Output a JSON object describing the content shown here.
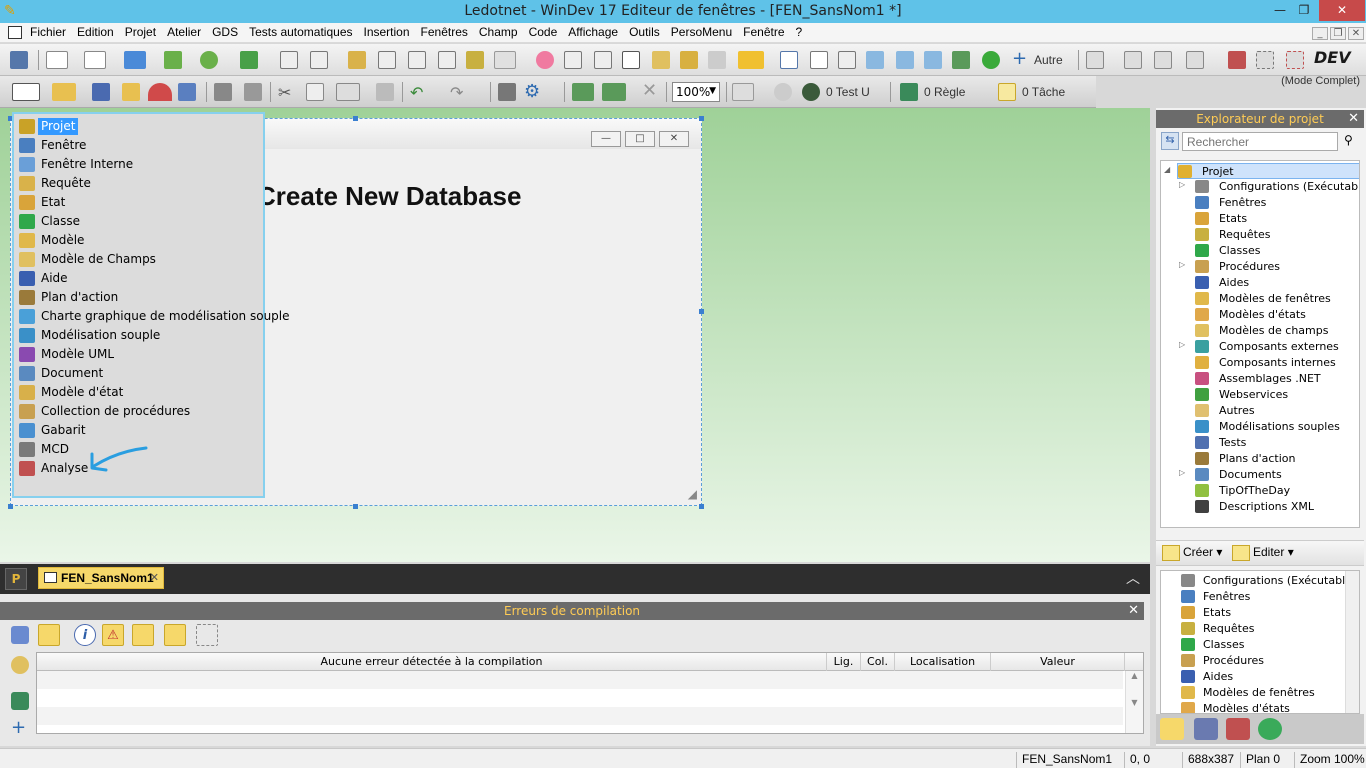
{
  "window": {
    "title": "Ledotnet - WinDev 17  Editeur de fenêtres - [FEN_SansNom1 *]",
    "minimize": "—",
    "restore": "❐",
    "close": "✕"
  },
  "menubar": {
    "items": [
      "Fichier",
      "Edition",
      "Projet",
      "Atelier",
      "GDS",
      "Tests automatiques",
      "Insertion",
      "Fenêtres",
      "Champ",
      "Code",
      "Affichage",
      "Outils",
      "PersoMenu",
      "Fenêtre",
      "?"
    ],
    "mdi_minimize": "_",
    "mdi_restore": "❐",
    "mdi_close": "✕"
  },
  "toolbar1": {
    "autre_label": "Autre",
    "mode_label": "(Mode Complet)",
    "logo": "DEV"
  },
  "toolbar2": {
    "zoom": "100%",
    "test_label": "0 Test U",
    "regle_label": "0 Règle",
    "tache_label": "0 Tâche"
  },
  "editor": {
    "heading": "Create New Database",
    "min_btn": "—",
    "max_btn": "□",
    "close_btn": "✕",
    "grip": "◢"
  },
  "new_menu": {
    "items": [
      {
        "label": "Projet",
        "color": "#c9a227",
        "selected": true
      },
      {
        "label": "Fenêtre",
        "color": "#4a7fc0"
      },
      {
        "label": "Fenêtre Interne",
        "color": "#6a9fd8"
      },
      {
        "label": "Requête",
        "color": "#d9b24a"
      },
      {
        "label": "Etat",
        "color": "#d9a43a"
      },
      {
        "label": "Classe",
        "color": "#2fa84a"
      },
      {
        "label": "Modèle",
        "color": "#e0b84a"
      },
      {
        "label": "Modèle de Champs",
        "color": "#e0c060"
      },
      {
        "label": "Aide",
        "color": "#3a5fb0"
      },
      {
        "label": "Plan d'action",
        "color": "#9a7a3a"
      },
      {
        "label": "Charte graphique de modélisation souple",
        "color": "#4aa0d8"
      },
      {
        "label": "Modélisation souple",
        "color": "#3a90c8"
      },
      {
        "label": "Modèle UML",
        "color": "#8a4ab0"
      },
      {
        "label": "Document",
        "color": "#5a8ac0"
      },
      {
        "label": "Modèle d'état",
        "color": "#d8b04a"
      },
      {
        "label": "Collection de procédures",
        "color": "#c8a050"
      },
      {
        "label": "Gabarit",
        "color": "#4a90d0"
      },
      {
        "label": "MCD",
        "color": "#7a7a7a"
      },
      {
        "label": "Analyse",
        "color": "#c05050"
      }
    ]
  },
  "explorer": {
    "title": "Explorateur de projet",
    "close": "✕",
    "search_placeholder": "Rechercher",
    "sync": "⇆",
    "binoculars": "⚲",
    "root": "Projet",
    "tree": [
      {
        "label": "Configurations (Exécutable",
        "color": "#888888",
        "expandable": true
      },
      {
        "label": "Fenêtres",
        "color": "#4a7fc0",
        "expandable": false
      },
      {
        "label": "Etats",
        "color": "#d9a43a",
        "expandable": false
      },
      {
        "label": "Requêtes",
        "color": "#c8b040",
        "expandable": false
      },
      {
        "label": "Classes",
        "color": "#2fa84a",
        "expandable": false
      },
      {
        "label": "Procédures",
        "color": "#c8a050",
        "expandable": true
      },
      {
        "label": "Aides",
        "color": "#3a5fb0",
        "expandable": false
      },
      {
        "label": "Modèles de fenêtres",
        "color": "#e0b84a",
        "expandable": false
      },
      {
        "label": "Modèles d'états",
        "color": "#e0a84a",
        "expandable": false
      },
      {
        "label": "Modèles de champs",
        "color": "#e0c060",
        "expandable": false
      },
      {
        "label": "Composants externes",
        "color": "#3aa0a0",
        "expandable": true
      },
      {
        "label": "Composants internes",
        "color": "#e0b040",
        "expandable": false
      },
      {
        "label": "Assemblages .NET",
        "color": "#c85080",
        "expandable": false
      },
      {
        "label": "Webservices",
        "color": "#40a040",
        "expandable": false
      },
      {
        "label": "Autres",
        "color": "#e0c070",
        "expandable": false
      },
      {
        "label": "Modélisations souples",
        "color": "#3a90c8",
        "expandable": false
      },
      {
        "label": "Tests",
        "color": "#5070b0",
        "expandable": false
      },
      {
        "label": "Plans d'action",
        "color": "#9a7a3a",
        "expandable": false
      },
      {
        "label": "Documents",
        "color": "#5a8ac0",
        "expandable": true
      },
      {
        "label": "TipOfTheDay",
        "color": "#90c040",
        "expandable": false
      },
      {
        "label": "Descriptions XML",
        "color": "#404040",
        "expandable": false
      }
    ],
    "creer_label": "Créer",
    "editer_label": "Editer",
    "tree2": [
      {
        "label": "Configurations (Exécutable",
        "color": "#888888"
      },
      {
        "label": "Fenêtres",
        "color": "#4a7fc0"
      },
      {
        "label": "Etats",
        "color": "#d9a43a"
      },
      {
        "label": "Requêtes",
        "color": "#c8b040"
      },
      {
        "label": "Classes",
        "color": "#2fa84a"
      },
      {
        "label": "Procédures",
        "color": "#c8a050"
      },
      {
        "label": "Aides",
        "color": "#3a5fb0"
      },
      {
        "label": "Modèles de fenêtres",
        "color": "#e0b84a"
      },
      {
        "label": "Modèles d'états",
        "color": "#e0a84a"
      }
    ]
  },
  "pane": {
    "tab_label": "FEN_SansNom1",
    "tab_close": "✕",
    "left_btn": "P",
    "collapse": "︿"
  },
  "errors": {
    "title": "Erreurs de compilation",
    "close": "✕",
    "info_glyph": "i",
    "warn_glyph": "⚠",
    "columns": [
      "Aucune erreur détectée à la compilation",
      "Lig.",
      "Col.",
      "Localisation",
      "Valeur"
    ]
  },
  "statusbar": {
    "window_name": "FEN_SansNom1",
    "coords": "0, 0",
    "size": "688x387",
    "plan": "Plan 0",
    "zoom": "Zoom 100%"
  }
}
